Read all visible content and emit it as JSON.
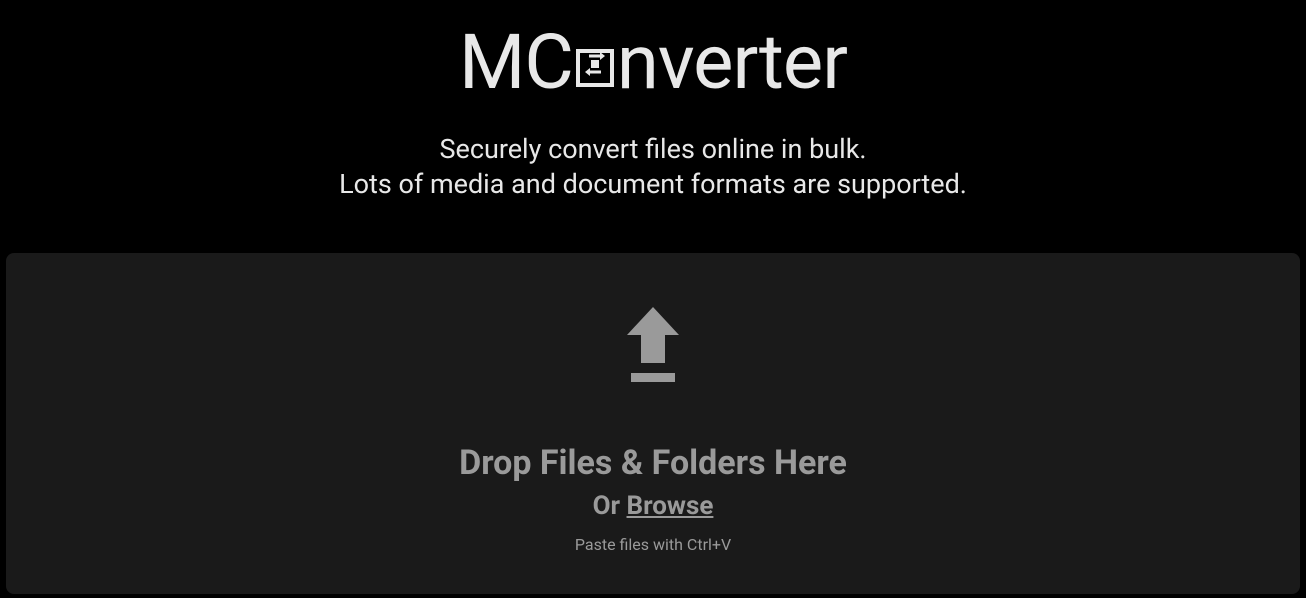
{
  "logo": {
    "text_left": "MC",
    "text_right": "nverter",
    "icon": "convert-icon"
  },
  "tagline": {
    "line1": "Securely convert files online in bulk.",
    "line2": "Lots of media and document formats are supported."
  },
  "dropzone": {
    "title": "Drop Files & Folders Here",
    "or_text": "Or ",
    "browse_text": "Browse",
    "paste_hint": "Paste files with Ctrl+V",
    "icon": "upload-icon"
  }
}
